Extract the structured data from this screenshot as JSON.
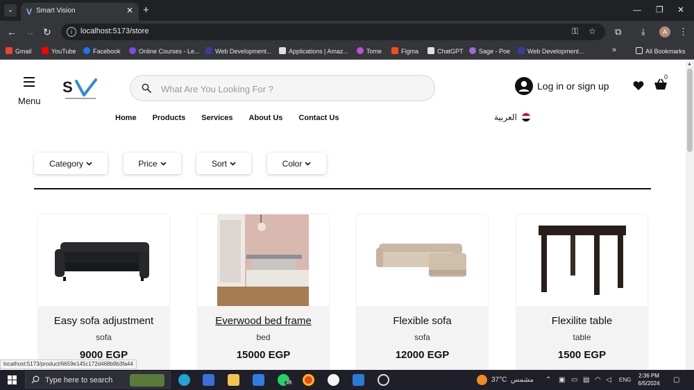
{
  "browser": {
    "tab_title": "Smart Vision",
    "tab_favicon": "V",
    "url": "localhost:5173/store",
    "profile_initial": "A",
    "bookmarks": [
      {
        "label": "Gmail",
        "color": "#ea4335"
      },
      {
        "label": "YouTube",
        "color": "#ff0000"
      },
      {
        "label": "Facebook",
        "color": "#1877f2"
      },
      {
        "label": "Online Courses - Le...",
        "color": "#7b4fe0"
      },
      {
        "label": "Web Development...",
        "color": "#3b3b9a"
      },
      {
        "label": "Applications | Amaz...",
        "color": "#e0e0e0"
      },
      {
        "label": "Tome",
        "color": "#c84be0"
      },
      {
        "label": "Figma",
        "color": "#f24e1e"
      },
      {
        "label": "ChatGPT",
        "color": "#e0e0e0"
      },
      {
        "label": "Sage - Poe",
        "color": "#9b6bd6"
      },
      {
        "label": "Web Development...",
        "color": "#3b3b9a"
      }
    ],
    "all_bookmarks": "All Bookmarks",
    "status_url": "localhost:5173/product/6659e145c172d468b9b3fa44"
  },
  "header": {
    "menu_label": "Menu",
    "search_placeholder": "What Are You Looking For ?",
    "login_label": "Log in or sign up",
    "cart_count": "0",
    "language": "العربية"
  },
  "nav": [
    "Home",
    "Products",
    "Services",
    "About Us",
    "Contact Us"
  ],
  "filters": [
    "Category",
    "Price",
    "Sort",
    "Color"
  ],
  "products": [
    {
      "name": "Easy sofa adjustment",
      "category": "sofa",
      "price": "9000 EGP"
    },
    {
      "name": "Everwood bed frame",
      "category": "bed",
      "price": "15000 EGP"
    },
    {
      "name": "Flexible sofa",
      "category": "sofa",
      "price": "12000 EGP"
    },
    {
      "name": "Flexilite table",
      "category": "table",
      "price": "1500 EGP"
    }
  ],
  "taskbar": {
    "search_text": "Type here to search",
    "whatsapp_badge": "39",
    "temperature": "37°C",
    "weather": "مشمس",
    "language": "ENG",
    "time": "2:36 PM",
    "date": "6/5/2024"
  },
  "colors": {
    "accent_blue": "#2a8bd6",
    "text": "#111111"
  }
}
